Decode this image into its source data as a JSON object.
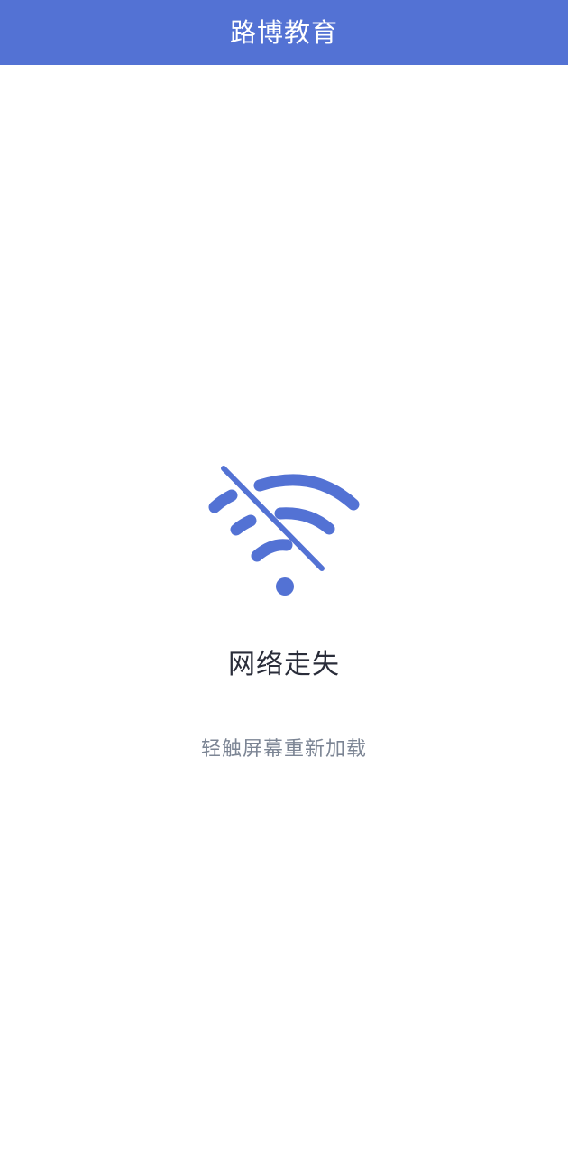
{
  "header": {
    "title": "路博教育"
  },
  "error": {
    "icon": "wifi-off-icon",
    "title": "网络走失",
    "hint": "轻触屏幕重新加载"
  },
  "colors": {
    "header_bg": "#5372d4",
    "icon": "#5372d4",
    "title_text": "#2a2d3a",
    "hint_text": "#7c8594",
    "background": "#ffffff"
  }
}
